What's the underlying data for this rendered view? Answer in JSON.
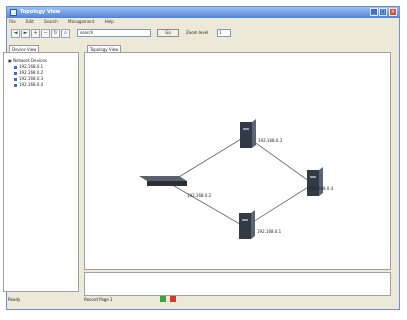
{
  "window": {
    "title": "Topology View"
  },
  "menu": [
    "File",
    "Edit",
    "Search",
    "Management",
    "Help"
  ],
  "toolbar": {
    "buttons": [
      {
        "icon": "back-arrow-icon",
        "glyph": "◄"
      },
      {
        "icon": "forward-arrow-icon",
        "glyph": "►"
      },
      {
        "icon": "zoom-in-icon",
        "glyph": "+"
      },
      {
        "icon": "zoom-out-icon",
        "glyph": "−"
      },
      {
        "icon": "refresh-icon",
        "glyph": "↻"
      },
      {
        "icon": "find-icon",
        "glyph": "⌕"
      }
    ],
    "search_value": "search",
    "go_label": "Go",
    "zoom_label": "Zoom level",
    "zoom_value": "1"
  },
  "left_panel": {
    "tab_label": "Device View",
    "tree": {
      "root": "Network Devices",
      "items": [
        "192.168.0.1",
        "192.168.0.2",
        "192.168.0.3",
        "192.168.0.4"
      ]
    }
  },
  "main_panel": {
    "tab_label": "Topology View",
    "nodes": [
      {
        "type": "switch",
        "label": "192.168.0.2"
      },
      {
        "type": "router",
        "label": "192.168.0.3"
      },
      {
        "type": "router",
        "label": "192.168.0.4"
      },
      {
        "type": "router",
        "label": "192.168.0.1"
      }
    ],
    "links": [
      [
        0,
        1
      ],
      [
        1,
        2
      ],
      [
        2,
        3
      ],
      [
        3,
        0
      ]
    ]
  },
  "status": {
    "left": "Ready",
    "page": "Record Page 1",
    "colors": [
      "#3fa33f",
      "#d23a2a"
    ]
  }
}
